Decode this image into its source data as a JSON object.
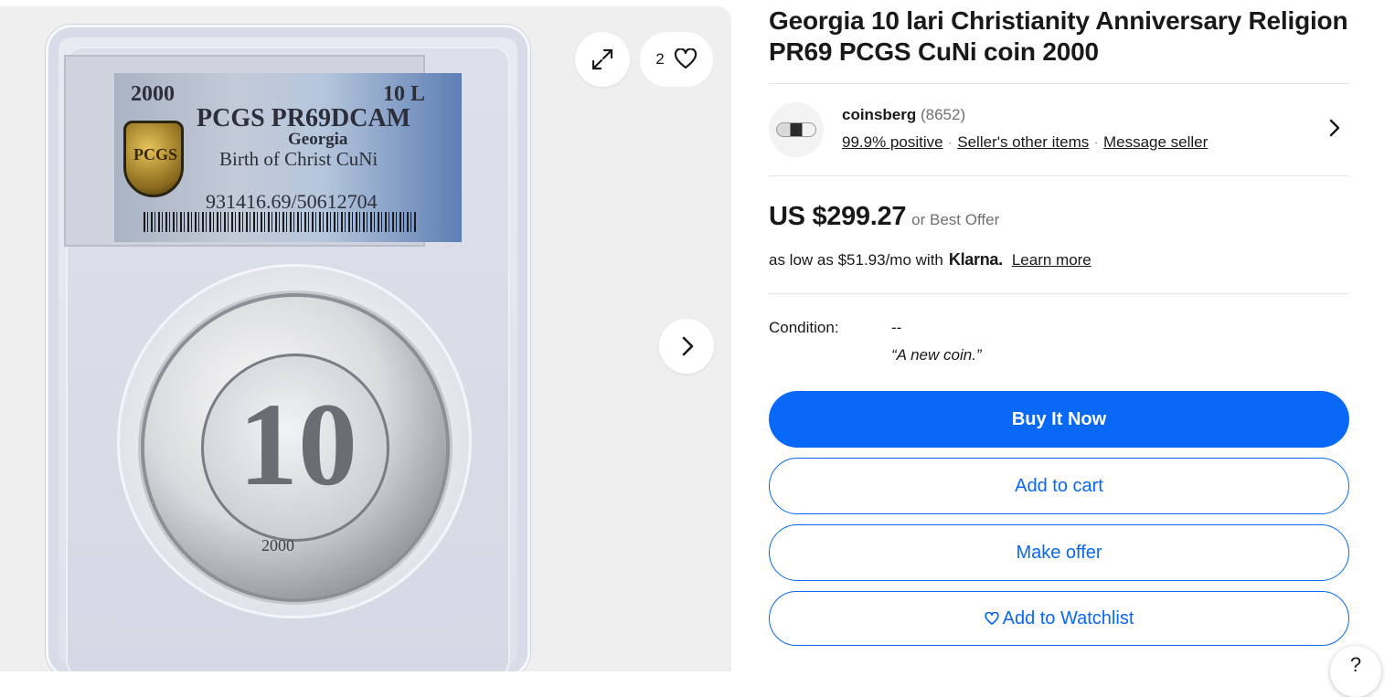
{
  "gallery": {
    "label_year": "2000",
    "label_denomination": "10 L",
    "label_grade": "PCGS PR69DCAM",
    "label_country": "Georgia",
    "label_description": "Birth of Christ CuNi",
    "label_cert": "931416.69/50612704",
    "label_logo": "PCGS",
    "coin_numeral": "10",
    "coin_year": "2000",
    "watch_count": "2",
    "icons": {
      "expand": "expand-icon",
      "heart": "heart-icon",
      "next": "chevron-right-icon"
    }
  },
  "listing": {
    "title": "Georgia 10 lari Christianity Anniversary Religion PR69 PCGS CuNi coin 2000"
  },
  "seller": {
    "name": "coinsberg",
    "feedback_count": "(8652)",
    "positive": "99.9% positive",
    "other_items": "Seller's other items",
    "message": "Message seller"
  },
  "price": {
    "amount": "US $299.27",
    "offer": "or Best Offer",
    "klarna_prefix": "as low as $51.93/mo with",
    "klarna_brand": "Klarna.",
    "learn_more": "Learn more"
  },
  "condition": {
    "label": "Condition:",
    "value": "--",
    "note": "“A new coin.”"
  },
  "actions": {
    "buy_now": "Buy It Now",
    "add_to_cart": "Add to cart",
    "make_offer": "Make offer",
    "watchlist": "Add to Watchlist"
  },
  "help": "?",
  "colors": {
    "primary": "#0968f6",
    "text": "#191919",
    "muted": "#707070",
    "gallery_bg": "#efefef"
  }
}
